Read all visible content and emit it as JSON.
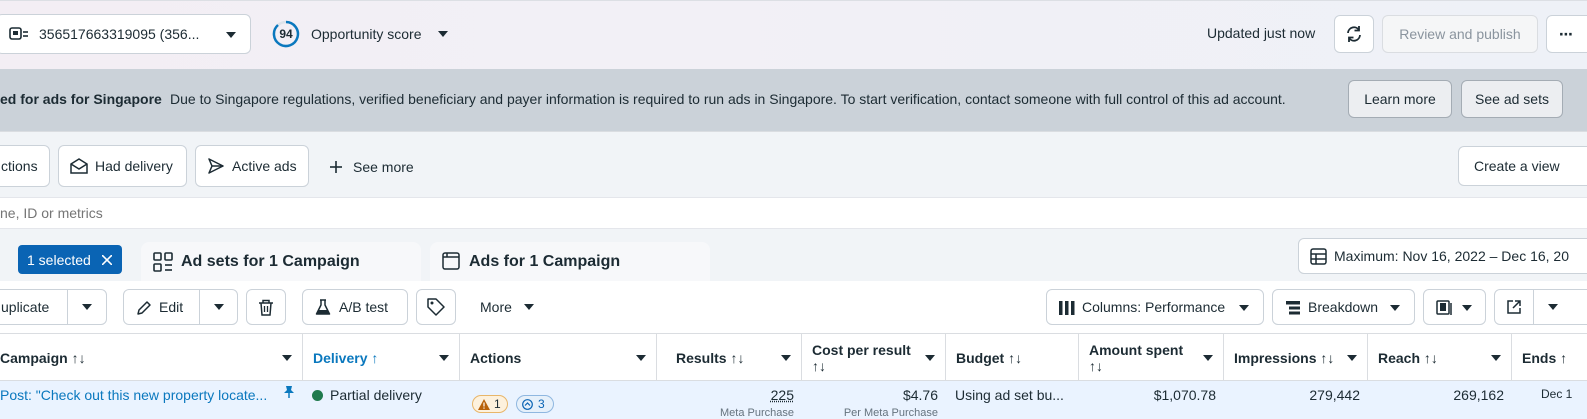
{
  "topbar": {
    "account_label": "356517663319095 (356...",
    "opportunity_score": "94",
    "opportunity_label": "Opportunity score",
    "updated_text": "Updated just now",
    "review_publish": "Review and publish",
    "more_label": "⋯"
  },
  "banner": {
    "title": "ed for ads for Singapore",
    "message": "Due to Singapore regulations, verified beneficiary and payer information is required to run ads in Singapore. To start verification, contact someone with full control of this ad account.",
    "learn_more": "Learn more",
    "see_ad_sets": "See ad sets"
  },
  "filters": {
    "actions": "ctions",
    "had_delivery": "Had delivery",
    "active_ads": "Active ads",
    "see_more": "See more",
    "create_view": "Create a view"
  },
  "search": {
    "placeholder": "ne, ID or metrics"
  },
  "tabs": {
    "selected": "1 selected",
    "ad_sets": "Ad sets for 1 Campaign",
    "ads": "Ads for 1 Campaign",
    "date_range": "Maximum: Nov 16, 2022 – Dec 16, 20"
  },
  "toolbar": {
    "duplicate": "uplicate",
    "edit": "Edit",
    "ab_test": "A/B test",
    "more": "More",
    "columns": "Columns: Performance",
    "breakdown": "Breakdown"
  },
  "table": {
    "headers": {
      "campaign": "Campaign ↑↓",
      "delivery": "Delivery ↑",
      "actions": "Actions",
      "results": "Results ↑↓",
      "cost_per_result": "Cost per result",
      "cost_sort": "↑↓",
      "budget": "Budget ↑↓",
      "amount_spent": "Amount spent",
      "amount_sort": "↑↓",
      "impressions": "Impressions ↑↓",
      "reach": "Reach ↑↓",
      "ends": "Ends ↑"
    },
    "row": {
      "campaign": "Post: \"Check out this new property locate...",
      "delivery": "Partial delivery",
      "warning_count": "1",
      "info_count": "3",
      "results": "225",
      "results_sub": "Meta Purchase",
      "cost": "$4.76",
      "cost_sub": "Per Meta Purchase",
      "budget": "Using ad set bu...",
      "amount": "$1,070.78",
      "impressions": "279,442",
      "reach": "269,162",
      "ends": "Dec 1"
    }
  },
  "colors": {
    "accent": "#0a78be",
    "selected_chip": "#0a64b4",
    "delivery_dot": "#1f7a4d"
  }
}
